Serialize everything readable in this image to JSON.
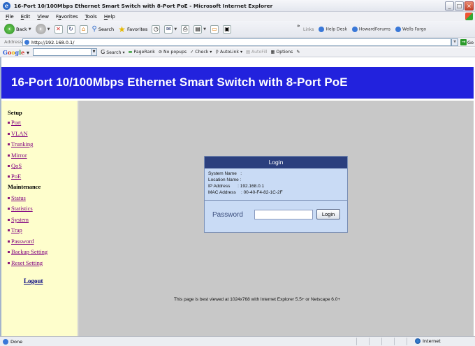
{
  "window": {
    "title": "16-Port 10/100Mbps Ethernet Smart Switch with 8-Port PoE - Microsoft Internet Explorer",
    "controls": {
      "minimize": "_",
      "maximize": "□",
      "close": "×"
    }
  },
  "menubar": {
    "items": [
      {
        "pre": "",
        "ul": "F",
        "post": "ile"
      },
      {
        "pre": "",
        "ul": "E",
        "post": "dit"
      },
      {
        "pre": "",
        "ul": "V",
        "post": "iew"
      },
      {
        "pre": "F",
        "ul": "a",
        "post": "vorites"
      },
      {
        "pre": "",
        "ul": "T",
        "post": "ools"
      },
      {
        "pre": "",
        "ul": "H",
        "post": "elp"
      }
    ]
  },
  "toolbar": {
    "back_label": "Back",
    "search_label": "Search",
    "favorites_label": "Favorites",
    "chevron": "»",
    "links_label": "Links",
    "links": [
      "Help Desk",
      "HowardForums",
      "Wells Fargo"
    ]
  },
  "addressbar": {
    "label": "Address",
    "url": "http://192.168.0.1/",
    "go_label": "Go"
  },
  "googlebar": {
    "logo_parts": [
      "G",
      "o",
      "o",
      "g",
      "l",
      "e"
    ],
    "search_label": "Search",
    "pagerank_label": "PageRank",
    "popups_label": "No popups",
    "check_label": "Check",
    "autolink_label": "AutoLink",
    "autofill_label": "AutoFill",
    "options_label": "Options"
  },
  "page": {
    "banner_title": "16-Port 10/100Mbps Ethernet Smart Switch with 8-Port PoE",
    "sidebar": {
      "setup_heading": "Setup",
      "setup_links": [
        "Port",
        "VLAN",
        "Trunking",
        "Mirror",
        "QoS",
        "PoE"
      ],
      "maintenance_heading": "Maintenance",
      "maintenance_links": [
        "Status",
        "Statistics",
        "System",
        "Trap",
        "Password",
        "Backup Setting",
        "Reset Setting"
      ],
      "logout": "Logout"
    },
    "login": {
      "title": "Login",
      "system_name": "System Name   :",
      "location_name": "Location Name :",
      "ip_address": "IP Address      : 192.168.0.1",
      "mac_address": "MAC Address    : 00-40-F4-82-1C-2F",
      "password_label": "Password",
      "password_value": "",
      "button_label": "Login"
    },
    "footnote": "This page is best viewed at 1024x768 with Internet Explorer 5.5+ or Netscape 6.0+"
  },
  "statusbar": {
    "left_text": "Done",
    "zone_text": "Internet"
  }
}
